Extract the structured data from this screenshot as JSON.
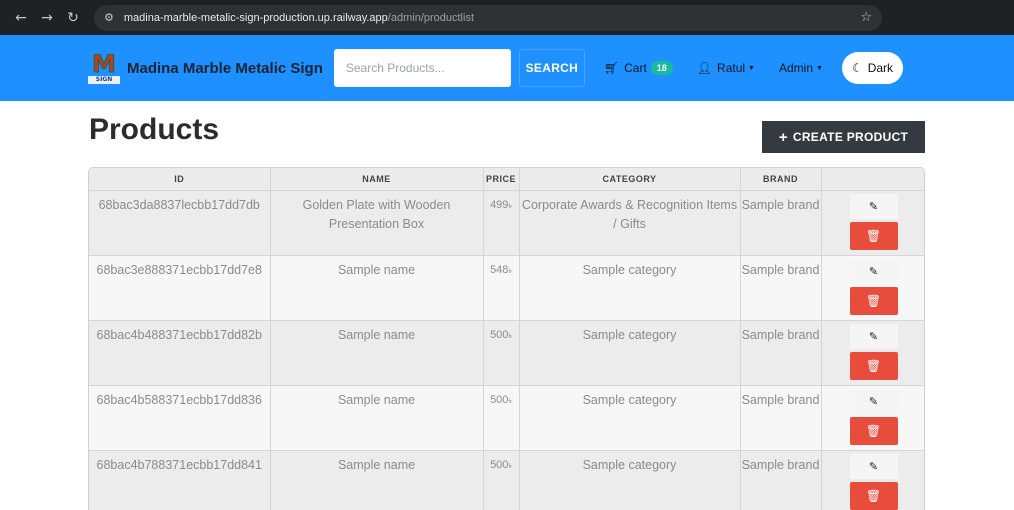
{
  "browser": {
    "url_host": "madina-marble-metalic-sign-production.up.railway.app",
    "url_path": "/admin/productlist"
  },
  "navbar": {
    "logo_letter": "M",
    "logo_sub": "SIGN",
    "brand": "Madina Marble Metalic Sign",
    "search_placeholder": "Search Products...",
    "search_button": "SEARCH",
    "cart_label": "Cart",
    "cart_count": "18",
    "user_label": "Ratul",
    "admin_label": "Admin",
    "theme_label": "Dark"
  },
  "page": {
    "title": "Products",
    "create_button": "CREATE PRODUCT"
  },
  "table": {
    "headers": [
      "ID",
      "NAME",
      "PRICE",
      "CATEGORY",
      "BRAND"
    ],
    "rows": [
      {
        "id": "68bac3da8837lecbb17dd7db",
        "name": "Golden Plate with Wooden Presentation Box",
        "price": "499",
        "category": "Corporate Awards & Recognition Items / Gifts",
        "brand": "Sample brand"
      },
      {
        "id": "68bac3e888371ecbb17dd7e8",
        "name": "Sample name",
        "price": "548",
        "category": "Sample category",
        "brand": "Sample brand"
      },
      {
        "id": "68bac4b488371ecbb17dd82b",
        "name": "Sample name",
        "price": "500",
        "category": "Sample category",
        "brand": "Sample brand"
      },
      {
        "id": "68bac4b588371ecbb17dd836",
        "name": "Sample name",
        "price": "500",
        "category": "Sample category",
        "brand": "Sample brand"
      },
      {
        "id": "68bac4b788371ecbb17dd841",
        "name": "Sample name",
        "price": "500",
        "category": "Sample category",
        "brand": "Sample brand"
      }
    ]
  },
  "colors": {
    "navbar_bg": "#1e90ff",
    "delete_red": "#e74c3c",
    "badge_green": "#18bc9c",
    "create_btn_bg": "#343a40"
  }
}
